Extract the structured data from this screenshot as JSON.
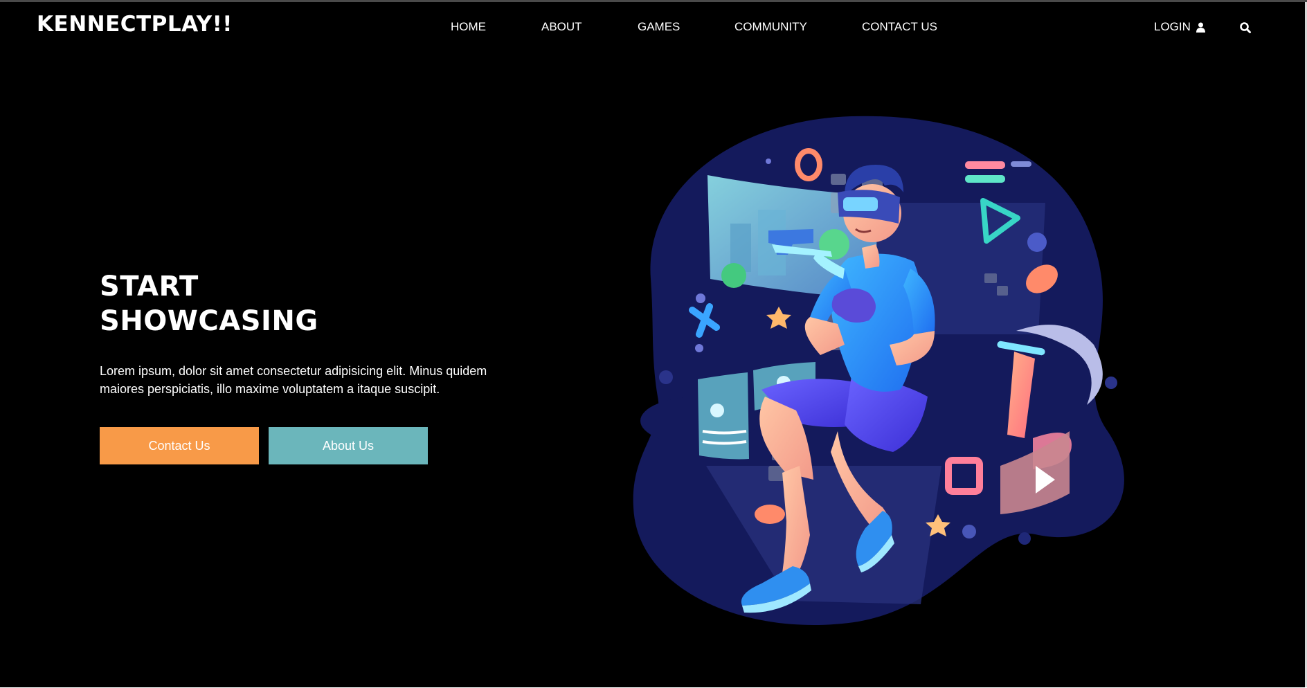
{
  "header": {
    "brand": "KENNECTPLAY!!",
    "nav": [
      "HOME",
      "ABOUT",
      "GAMES",
      "COMMUNITY",
      "CONTACT US"
    ],
    "login_label": "LOGIN",
    "icons": {
      "login": "user-icon",
      "search": "search-icon"
    }
  },
  "hero": {
    "title_line1": "START",
    "title_line2": "SHOWCASING",
    "text": "Lorem ipsum, dolor sit amet consectetur adipisicing elit. Minus quidem maiores perspiciatis, illo maxime voluptatem a itaque suscipit.",
    "buttons": {
      "contact": "Contact Us",
      "about": "About Us"
    }
  },
  "colors": {
    "background": "#000000",
    "text": "#ffffff",
    "contact_button": "#f89a48",
    "about_button": "#6bb6bb",
    "illustration_blob": "#141a5c"
  }
}
